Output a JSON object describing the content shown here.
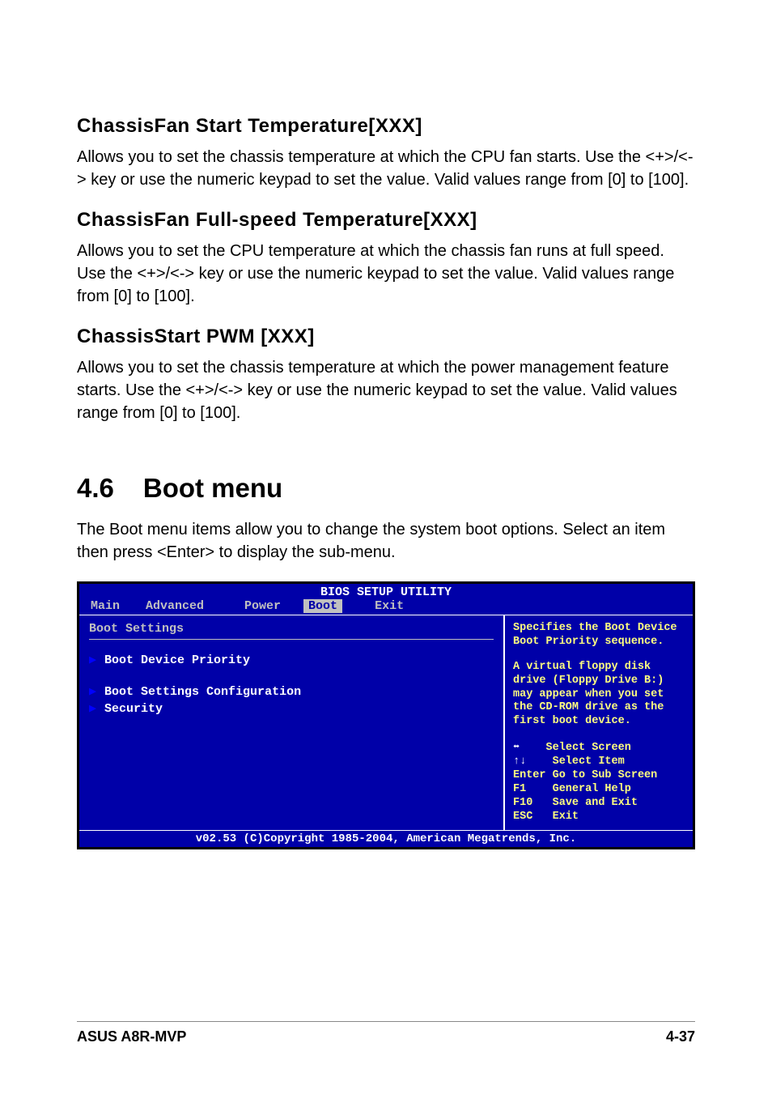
{
  "sections": {
    "s1": {
      "heading": "ChassisFan Start Temperature[XXX]",
      "body": "Allows you to set the chassis temperature at which the CPU fan starts. Use the <+>/<-> key or use the numeric keypad to set the value. Valid values range from [0] to [100]."
    },
    "s2": {
      "heading": "ChassisFan Full-speed Temperature[XXX]",
      "body": "Allows you to set the CPU temperature at which the chassis fan runs at full speed. Use the <+>/<-> key or use the numeric keypad to set the value. Valid values range from [0] to [100]."
    },
    "s3": {
      "heading": "ChassisStart PWM [XXX]",
      "body": "Allows you to set the chassis temperature at which the power management feature starts. Use the <+>/<-> key or use the numeric keypad to set the value. Valid values range from [0] to [100]."
    }
  },
  "main": {
    "num": "4.6",
    "title": "Boot menu",
    "intro": "The Boot menu items allow you to change the system boot options. Select an item then press <Enter> to display the sub-menu."
  },
  "bios": {
    "title": "BIOS SETUP UTILITY",
    "tabs": {
      "main": "Main",
      "advanced": "Advanced",
      "power": "Power",
      "boot": "Boot",
      "exit": "Exit"
    },
    "left": {
      "heading": "Boot Settings",
      "items": [
        "Boot Device Priority",
        "Boot Settings Configuration",
        "Security"
      ]
    },
    "right": {
      "help1": "Specifies the Boot Device Boot Priority sequence.",
      "help2": "A virtual floppy disk drive (Floppy Drive B:) may appear when you set the CD-ROM drive as the first boot device.",
      "keys": {
        "k1": "Select Screen",
        "k2": "Select Item",
        "k3l": "Enter",
        "k3r": "Go to Sub Screen",
        "k4l": "F1",
        "k4r": "General Help",
        "k5l": "F10",
        "k5r": "Save and Exit",
        "k6l": "ESC",
        "k6r": "Exit"
      }
    },
    "footer": "v02.53 (C)Copyright 1985-2004, American Megatrends, Inc."
  },
  "footer": {
    "left": "ASUS A8R-MVP",
    "right": "4-37"
  }
}
